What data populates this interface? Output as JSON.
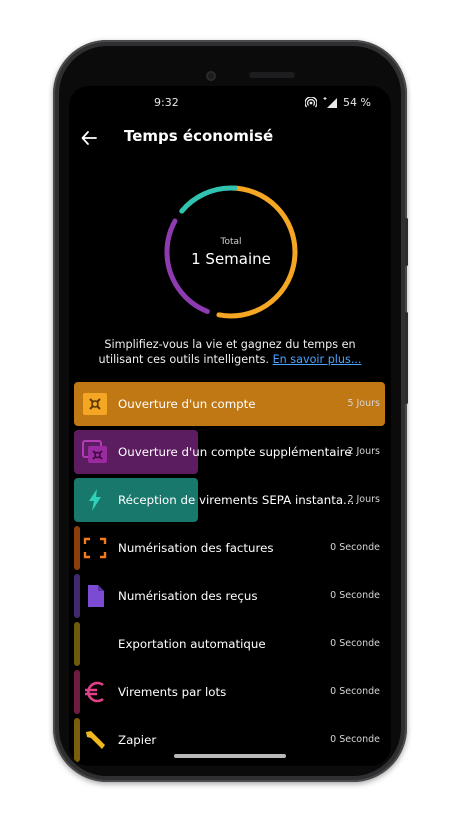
{
  "status_bar": {
    "time": "9:32",
    "battery": "54 %"
  },
  "app_bar": {
    "title": "Temps économisé"
  },
  "summary": {
    "label": "Total",
    "value": "1 Semaine"
  },
  "description": {
    "text": "Simplifiez-vous la vie et gagnez du temps en utilisant ces outils intelligents.",
    "link": "En savoir plus..."
  },
  "ring_segments_fraction": {
    "orange": 0.53,
    "purple": 0.27,
    "teal": 0.15
  },
  "colors": {
    "orange": "#f5a623",
    "purple": "#8e3ab1",
    "teal": "#2fc3b0"
  },
  "features": [
    {
      "label": "Ouverture d'un compte",
      "value": "5 Jours",
      "color": "#f5a623",
      "icon": "safe-icon"
    },
    {
      "label": "Ouverture d'un compte supplémentaire",
      "value": "2 Jours",
      "color": "#8e2e8e",
      "icon": "safes-icon"
    },
    {
      "label": "Réception de virements SEPA instanta...",
      "value": "2 Jours",
      "color": "#21a38f",
      "icon": "lightning-icon"
    },
    {
      "label": "Numérisation des factures",
      "value": "0 Seconde",
      "color": "#f27a1a",
      "icon": "scan-frame-icon"
    },
    {
      "label": "Numérisation des reçus",
      "value": "0 Seconde",
      "color": "#7b4bd4",
      "icon": "document-icon"
    },
    {
      "label": "Exportation automatique",
      "value": "0 Seconde",
      "color": "#c9a514",
      "icon": ""
    },
    {
      "label": "Virements par lots",
      "value": "0 Seconde",
      "color": "#e0408a",
      "icon": "euro-icon"
    },
    {
      "label": "Zapier",
      "value": "0 Seconde",
      "color": "#f0b91d",
      "icon": "wrench-icon"
    }
  ]
}
